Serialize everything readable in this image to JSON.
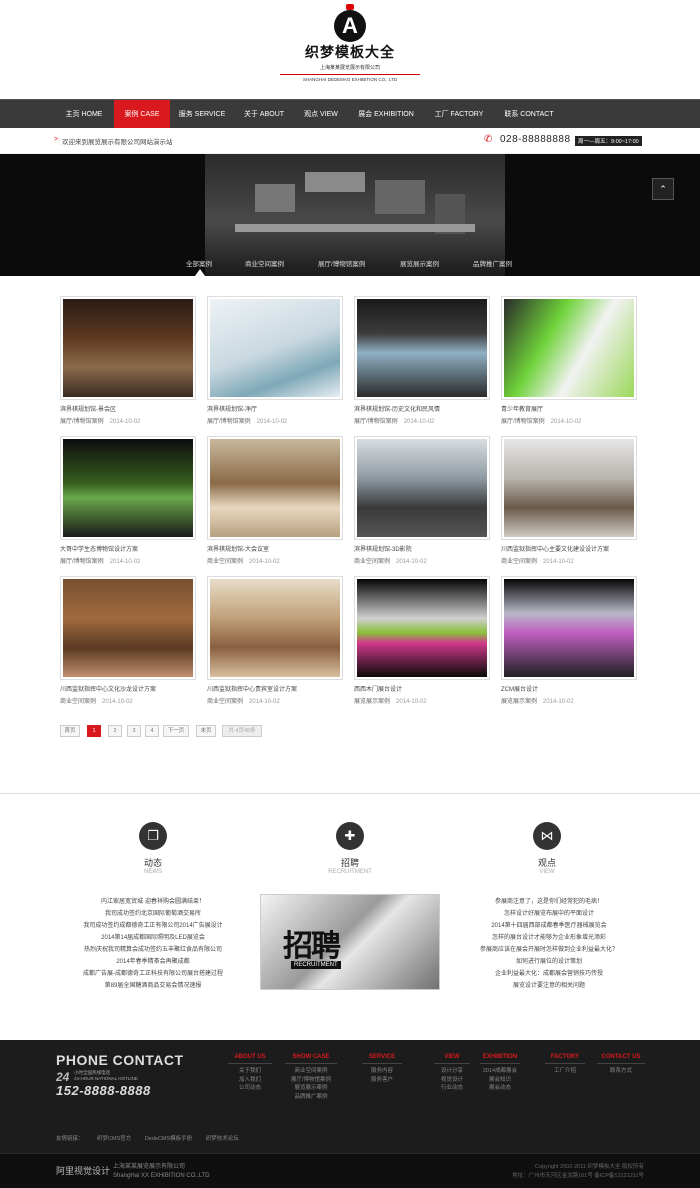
{
  "brand": {
    "logo_mark": "A",
    "name_cn": "织梦模板大全",
    "company_cn": "上海某某展览展示有限公司",
    "company_en": "SHANGHAI DEDEMAO EXHIBITION CO., LTD"
  },
  "nav": [
    {
      "label": "主页  HOME",
      "active": false
    },
    {
      "label": "案例  CASE",
      "active": true
    },
    {
      "label": "服务  SERVICE",
      "active": false
    },
    {
      "label": "关于  ABOUT",
      "active": false
    },
    {
      "label": "观点  VIEW",
      "active": false
    },
    {
      "label": "展会  EXHIBITION",
      "active": false
    },
    {
      "label": "工厂  FACTORY",
      "active": false
    },
    {
      "label": "联系  CONTACT",
      "active": false
    }
  ],
  "notice": {
    "arrow": ">",
    "text": "欢迎来到展览展示有限公司网站演示站",
    "phone": "028-88888888",
    "hours": "周一—周五：9:00~17:00"
  },
  "banner": {
    "up_icon": "chevron-up-icon",
    "up_glyph": "⌃"
  },
  "categories": [
    "全部案例",
    "商业空间案例",
    "展厅/博物馆案例",
    "展览展示案例",
    "品牌推广案例"
  ],
  "cases": [
    {
      "title": "滨界棋规划馆-景会区",
      "cat": "展厅/博物馆案例",
      "date": "2014-10-02",
      "bg": "linear-gradient(180deg,#2b1b14,#5e3a22 40%,#8b6a4a 70%,#3a2a20)"
    },
    {
      "title": "滨界棋规划馆-净厅",
      "cat": "展厅/博物馆案例",
      "date": "2014-10-02",
      "bg": "linear-gradient(160deg,#eef3f6,#c9d8e0 50%,#7ea8b8 75%,#e8eef2)"
    },
    {
      "title": "滨界棋规划馆-历史文化和民风情",
      "cat": "展厅/博物馆案例",
      "date": "2014-10-02",
      "bg": "linear-gradient(180deg,#1a1a1a,#3c3c3c 35%,#8fb0c4 55%,#2a2a2a)"
    },
    {
      "title": "青少年教育展厅",
      "cat": "展厅/博物馆案例",
      "date": "2014-10-02",
      "bg": "linear-gradient(120deg,#2a2a2a,#6fd23a 35%,#f2f2f2 60%,#9ad85a)"
    },
    {
      "title": "大哥中学生态博物馆设计方案",
      "cat": "展厅/博物馆案例",
      "date": "2014-10-02",
      "bg": "linear-gradient(180deg,#0d0d0d,#355e1e 45%,#6aa84a 60%,#1a1a1a)"
    },
    {
      "title": "滨界棋规划馆-大会议室",
      "cat": "商业空间案例",
      "date": "2014-10-02",
      "bg": "linear-gradient(180deg,#c9b89c,#8a6a48 45%,#e8d8c0 70%,#b8a080)"
    },
    {
      "title": "滨界棋规划馆-3D影院",
      "cat": "商业空间案例",
      "date": "2014-10-02",
      "bg": "linear-gradient(180deg,#d8dde0,#8e9aa2 40%,#3a3a3a 70%,#555)"
    },
    {
      "title": "川西监狱指挥中心主要文化建设设计方案",
      "cat": "商业空间案例",
      "date": "2014-10-02",
      "bg": "linear-gradient(180deg,#e6e6e6,#b8b4ae 40%,#6b5a48 70%,#cfcac2)"
    },
    {
      "title": "川西监狱指挥中心文化沙龙设计方案",
      "cat": "商业空间案例",
      "date": "2014-10-02",
      "bg": "linear-gradient(180deg,#7a5030,#a06a40 40%,#5a3a22 70%,#c09070)"
    },
    {
      "title": "川西监狱指挥中心贵宾室设计方案",
      "cat": "商业空间案例",
      "date": "2014-10-02",
      "bg": "linear-gradient(180deg,#e8dcc8,#c0a078 40%,#8a6040 70%,#d8c0a0)"
    },
    {
      "title": "西西木门展台设计",
      "cat": "展览展示案例",
      "date": "2014-10-02",
      "bg": "linear-gradient(180deg,#050505,#cfcfcf 40%,#8ac03a 55%,#d03a8a 65%,#0a0a0a)"
    },
    {
      "title": "ZCM展台设计",
      "cat": "展览展示案例",
      "date": "2014-10-02",
      "bg": "linear-gradient(180deg,#050505,#b8b8c8 35%,#c060c0 55%,#202020)"
    }
  ],
  "pager": {
    "first": "首页",
    "pages": [
      "1",
      "2",
      "3",
      "4"
    ],
    "next": "下一页",
    "last": "末页",
    "total": "共 4页48条"
  },
  "news": {
    "title": "动态",
    "en": "NEWS",
    "icon": "news-icon",
    "glyph": "❐",
    "items": [
      "内江家居宽贸城·迎春祥购会圆满结束！",
      "我司成功签约北京国际葡萄酒交易所",
      "我司成功签约成都德奇工正有限公司2014广告展设计",
      "2014第14届成都国际照明及LED展览会",
      "热烈庆祝我司精算会成功签约五丰聚红食品有限公司",
      "2014年春季精茶会再聚成都",
      "成都广告展-成都德奇工正科技有限公司展台搭建过程",
      "第89届全国糖酒商品交易会情况速报"
    ]
  },
  "recruit": {
    "title": "招聘",
    "en": "RECRUITMENT",
    "icon": "recruit-icon",
    "glyph": "✚",
    "big": "招聘",
    "small": "RECRUITMENT"
  },
  "views": {
    "title": "观点",
    "en": "VIEW",
    "icon": "view-icon",
    "glyph": "⋈",
    "items": [
      "参展商注意了，这是你们经常犯的毛病！",
      "怎样设计好展览布展中的平面设计",
      "2014第十四届西部成都春季医疗器械展览会",
      "怎样的展台设计才能够为企业形象增光添彩",
      "参展商应该在展会开展时怎样做到企业利益最大化？",
      "如何进行展位的设计策划",
      "企业利益最大化：成都展会营销技巧传授",
      "展览设计要注意的相关问题"
    ]
  },
  "footer": {
    "phone_contact": "PHONE CONTACT",
    "h24": "24",
    "h24_cn": "小时全国热线电话",
    "h24_en": "24-HOUR NATIONAL HOTLINE",
    "hotline": "152-8888-8888",
    "cols": [
      {
        "h": "ABOUT US",
        "items": [
          "关于我们",
          "加入我们",
          "公司动态"
        ]
      },
      {
        "h": "SHOW CASE",
        "items": [
          "商业空间案例",
          "展厅/博物馆案例",
          "展览展示案例",
          "品牌推广案例"
        ]
      },
      {
        "h": "SERVICE",
        "items": [
          "服务内容",
          "服务客户"
        ]
      },
      {
        "h": "VIEW",
        "items": [
          "设计分享",
          "视觉设计",
          "行业动态"
        ]
      },
      {
        "h": "EXHIBITION",
        "items": [
          "2014成都展会",
          "展会知识",
          "展会动态"
        ]
      },
      {
        "h": "FACTORY",
        "items": [
          "工厂介绍"
        ]
      },
      {
        "h": "CONTACT US",
        "items": [
          "联系方式"
        ]
      }
    ],
    "links_label": "友情链接：",
    "links": [
      "织梦CMS官方",
      "DedeCMS模板手册",
      "织梦技术论坛"
    ],
    "brand": "阿里视觉设计",
    "company_cn": "上海某某展览展示有限公司",
    "company_en": "ShangHai XX EXHIBITION CO.,LTD",
    "copyright": "Copyright 2002-2011 织梦模板大全 版权所有",
    "address": "地址：广州市天河区金龙路161号 备ICP备12121211号"
  }
}
